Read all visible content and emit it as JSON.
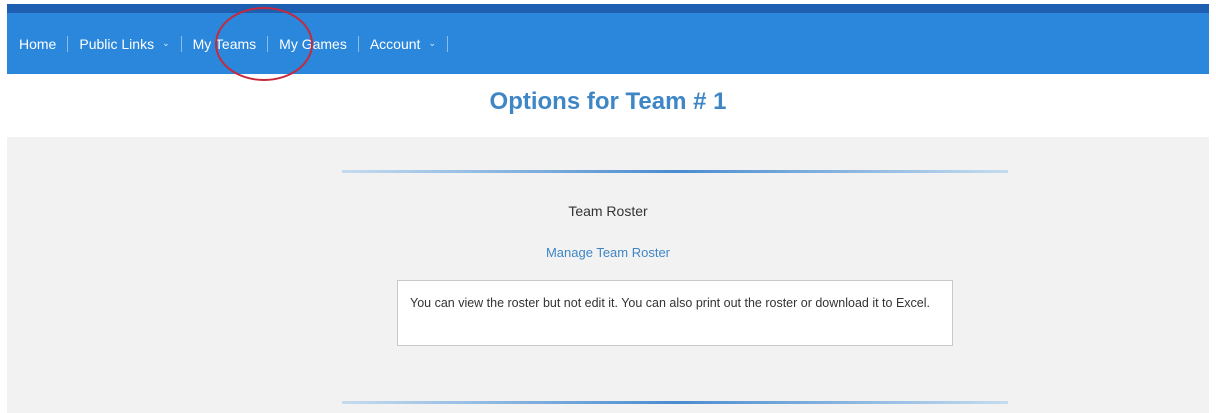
{
  "nav": {
    "items": [
      {
        "label": "Home",
        "has_dropdown": false
      },
      {
        "label": "Public Links",
        "has_dropdown": true
      },
      {
        "label": "My Teams",
        "has_dropdown": false
      },
      {
        "label": "My Games",
        "has_dropdown": false
      },
      {
        "label": "Account",
        "has_dropdown": true
      }
    ],
    "chevron": "⌄"
  },
  "page_title": "Options for Team # 1",
  "section": {
    "heading": "Team Roster",
    "link": "Manage Team Roster",
    "description": "You can view the roster but not edit it. You can also print out the roster or download it to Excel."
  },
  "colors": {
    "nav_bg": "#2a87db",
    "nav_top_band": "#1f5fb2",
    "accent_text": "#3f86c6",
    "highlight_circle": "#c8283a",
    "content_bg": "#f2f2f2"
  }
}
